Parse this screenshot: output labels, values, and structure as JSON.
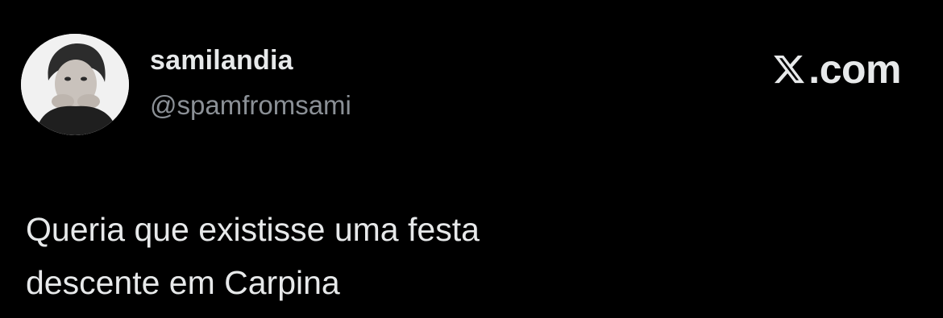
{
  "tweet": {
    "display_name": "samilandia",
    "handle": "@spamfromsami",
    "text": "Queria que existisse uma festa\ndescente em Carpina",
    "avatar_icon": "profile-photo"
  },
  "brand": {
    "logo_icon": "x-logo-icon",
    "label": ".com"
  },
  "colors": {
    "background": "#000000",
    "primary_text": "#e7e9ea",
    "secondary_text": "#8b9096"
  }
}
